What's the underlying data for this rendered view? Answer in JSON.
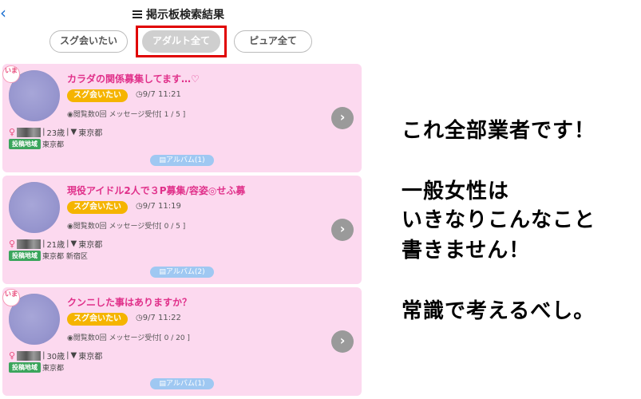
{
  "header": {
    "back_icon": "chevron-left-icon",
    "title": "掲示板検索結果",
    "title_icon": "list-icon"
  },
  "tabs": [
    {
      "label": "スグ会いたい",
      "active": false
    },
    {
      "label": "アダルト全て",
      "active": true
    },
    {
      "label": "ピュア全て",
      "active": false
    }
  ],
  "posts": [
    {
      "now_badge": "いま",
      "title": "カラダの関係募集してます…♡",
      "tag": "スグ会いたい",
      "time": "9/7 11:21",
      "stats": "閲覧数0回 メッセージ受付[ 1 / 5 ]",
      "gender": "♀",
      "age": "23歳",
      "location": "東京都",
      "region_badge": "投稿地域",
      "region": "東京都",
      "album": "アルバム(1)"
    },
    {
      "now_badge": "",
      "title": "現役アイドル2人で３P募集/容姿◎せふ募",
      "tag": "スグ会いたい",
      "time": "9/7 11:19",
      "stats": "閲覧数0回 メッセージ受付[ 0 / 5 ]",
      "gender": "♀",
      "age": "21歳",
      "location": "東京都",
      "region_badge": "投稿地域",
      "region": "東京都 新宿区",
      "album": "アルバム(2)"
    },
    {
      "now_badge": "いま",
      "title": "クンニした事はありますか？",
      "tag": "スグ会いたい",
      "time": "9/7 11:22",
      "stats": "閲覧数0回 メッセージ受付[ 0 / 20 ]",
      "gender": "♀",
      "age": "30歳",
      "location": "東京都",
      "region_badge": "投稿地域",
      "region": "東京都",
      "album": "アルバム(1)"
    }
  ],
  "caption": {
    "line1": "これ全部業者です！",
    "line2": "一般女性は",
    "line3": "いきなりこんなこと",
    "line4": "書きません！",
    "line5": "常識で考えるべし。"
  },
  "colors": {
    "card_bg": "#fcd9ef",
    "title_pink": "#e0308a",
    "tag_orange": "#f5b400",
    "region_green": "#3ba55c",
    "highlight_red": "#e00000"
  }
}
